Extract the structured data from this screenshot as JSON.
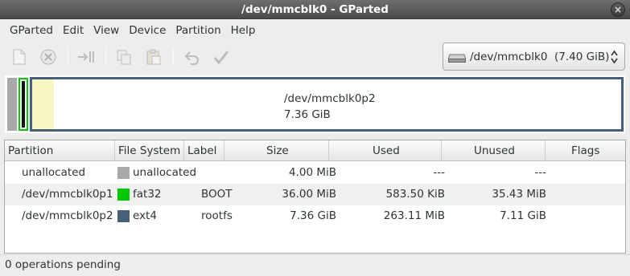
{
  "window": {
    "title": "/dev/mmcblk0 - GParted"
  },
  "menu": [
    "GParted",
    "Edit",
    "View",
    "Device",
    "Partition",
    "Help"
  ],
  "toolbar_icons": [
    "new-partition-icon",
    "delete-icon",
    "resize-move-icon",
    "copy-icon",
    "paste-icon",
    "undo-icon",
    "apply-icon"
  ],
  "device_selector": {
    "label": "/dev/mmcblk0  (7.40 GiB)"
  },
  "disk_map": {
    "selected_partition": {
      "name": "/dev/mmcblk0p2",
      "size": "7.36 GiB"
    },
    "colors": {
      "unallocated": "#a9a9a9",
      "fat32": "#00c800",
      "ext4": "#46607a",
      "used_space": "#f8f6c4"
    }
  },
  "table": {
    "headers": [
      "Partition",
      "File System",
      "Label",
      "Size",
      "Used",
      "Unused",
      "Flags"
    ],
    "rows": [
      {
        "partition": "unallocated",
        "fs": "unallocated",
        "fs_color": "#a9a9a9",
        "label": "",
        "size": "4.00 MiB",
        "used": "---",
        "unused": "---",
        "flags": ""
      },
      {
        "partition": "/dev/mmcblk0p1",
        "fs": "fat32",
        "fs_color": "#00c800",
        "label": "BOOT",
        "size": "36.00 MiB",
        "used": "583.50 KiB",
        "unused": "35.43 MiB",
        "flags": ""
      },
      {
        "partition": "/dev/mmcblk0p2",
        "fs": "ext4",
        "fs_color": "#46607a",
        "label": "rootfs",
        "size": "7.36 GiB",
        "used": "263.11 MiB",
        "unused": "7.11 GiB",
        "flags": ""
      }
    ]
  },
  "status": {
    "text": "0 operations pending"
  }
}
